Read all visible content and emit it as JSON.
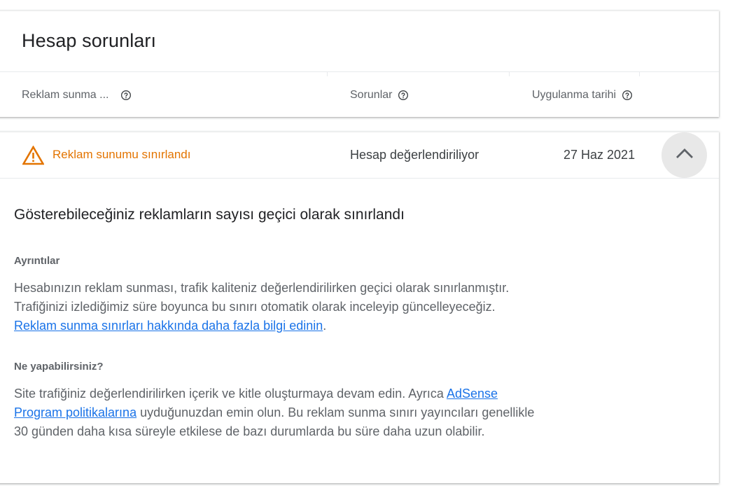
{
  "card": {
    "title": "Hesap sorunları",
    "headers": {
      "ad_serving": "Reklam sunma ...",
      "issues": "Sorunlar",
      "applied_date": "Uygulanma tarihi"
    }
  },
  "issue": {
    "status": "Reklam sunumu sınırlandı",
    "problem": "Hesap değerlendiriliyor",
    "date": "27 Haz 2021"
  },
  "detail": {
    "title": "Gösterebileceğiniz reklamların sayısı geçici olarak sınırlandı",
    "details_label": "Ayrıntılar",
    "details_text_1": "Hesabınızın reklam sunması, trafik kaliteniz değerlendirilirken geçici olarak sınırlanmıştır.",
    "details_text_2": "Trafiğinizi izlediğimiz süre boyunca bu sınırı otomatik olarak inceleyip güncelleyeceğiz.",
    "details_link": "Reklam sunma sınırları hakkında daha fazla bilgi edinin",
    "details_link_suffix": ".",
    "todo_label": "Ne yapabilirsiniz?",
    "todo_text_1": "Site trafiğiniz değerlendirilirken içerik ve kitle oluşturmaya devam edin. Ayrıca ",
    "todo_link": "AdSense Program politikalarına",
    "todo_text_2": " uyduğunuzdan emin olun. Bu reklam sunma sınırı yayıncıları genellikle 30 günden daha kısa süreyle etkilese de bazı durumlarda bu süre daha uzun olabilir."
  },
  "colors": {
    "warning": "#e37400",
    "link": "#1a73e8"
  },
  "icons": {
    "help": "help-outline-icon",
    "warning": "warning-triangle-icon",
    "collapse": "chevron-up-icon"
  }
}
